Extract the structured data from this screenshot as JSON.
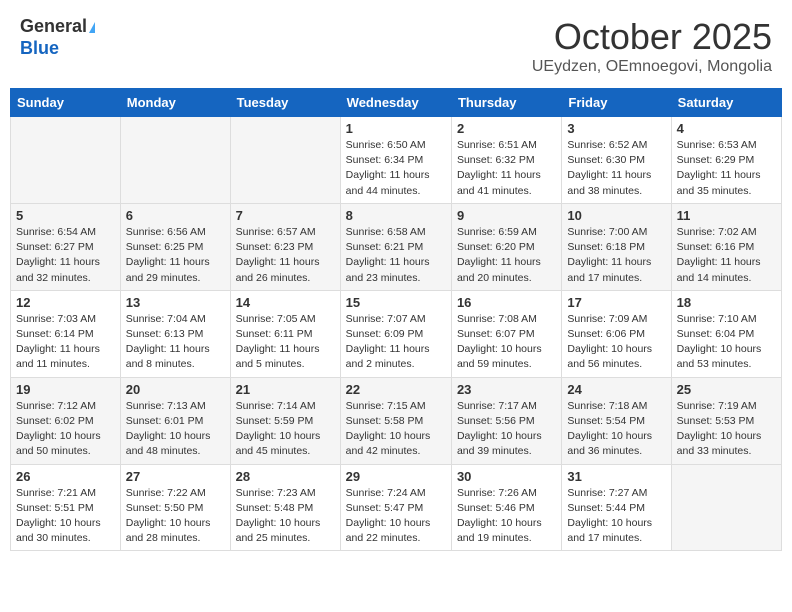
{
  "header": {
    "logo_general": "General",
    "logo_blue": "Blue",
    "month_title": "October 2025",
    "location": "UEydzen, OEmnoegovi, Mongolia"
  },
  "days_of_week": [
    "Sunday",
    "Monday",
    "Tuesday",
    "Wednesday",
    "Thursday",
    "Friday",
    "Saturday"
  ],
  "weeks": [
    [
      {
        "day": "",
        "info": ""
      },
      {
        "day": "",
        "info": ""
      },
      {
        "day": "",
        "info": ""
      },
      {
        "day": "1",
        "info": "Sunrise: 6:50 AM\nSunset: 6:34 PM\nDaylight: 11 hours\nand 44 minutes."
      },
      {
        "day": "2",
        "info": "Sunrise: 6:51 AM\nSunset: 6:32 PM\nDaylight: 11 hours\nand 41 minutes."
      },
      {
        "day": "3",
        "info": "Sunrise: 6:52 AM\nSunset: 6:30 PM\nDaylight: 11 hours\nand 38 minutes."
      },
      {
        "day": "4",
        "info": "Sunrise: 6:53 AM\nSunset: 6:29 PM\nDaylight: 11 hours\nand 35 minutes."
      }
    ],
    [
      {
        "day": "5",
        "info": "Sunrise: 6:54 AM\nSunset: 6:27 PM\nDaylight: 11 hours\nand 32 minutes."
      },
      {
        "day": "6",
        "info": "Sunrise: 6:56 AM\nSunset: 6:25 PM\nDaylight: 11 hours\nand 29 minutes."
      },
      {
        "day": "7",
        "info": "Sunrise: 6:57 AM\nSunset: 6:23 PM\nDaylight: 11 hours\nand 26 minutes."
      },
      {
        "day": "8",
        "info": "Sunrise: 6:58 AM\nSunset: 6:21 PM\nDaylight: 11 hours\nand 23 minutes."
      },
      {
        "day": "9",
        "info": "Sunrise: 6:59 AM\nSunset: 6:20 PM\nDaylight: 11 hours\nand 20 minutes."
      },
      {
        "day": "10",
        "info": "Sunrise: 7:00 AM\nSunset: 6:18 PM\nDaylight: 11 hours\nand 17 minutes."
      },
      {
        "day": "11",
        "info": "Sunrise: 7:02 AM\nSunset: 6:16 PM\nDaylight: 11 hours\nand 14 minutes."
      }
    ],
    [
      {
        "day": "12",
        "info": "Sunrise: 7:03 AM\nSunset: 6:14 PM\nDaylight: 11 hours\nand 11 minutes."
      },
      {
        "day": "13",
        "info": "Sunrise: 7:04 AM\nSunset: 6:13 PM\nDaylight: 11 hours\nand 8 minutes."
      },
      {
        "day": "14",
        "info": "Sunrise: 7:05 AM\nSunset: 6:11 PM\nDaylight: 11 hours\nand 5 minutes."
      },
      {
        "day": "15",
        "info": "Sunrise: 7:07 AM\nSunset: 6:09 PM\nDaylight: 11 hours\nand 2 minutes."
      },
      {
        "day": "16",
        "info": "Sunrise: 7:08 AM\nSunset: 6:07 PM\nDaylight: 10 hours\nand 59 minutes."
      },
      {
        "day": "17",
        "info": "Sunrise: 7:09 AM\nSunset: 6:06 PM\nDaylight: 10 hours\nand 56 minutes."
      },
      {
        "day": "18",
        "info": "Sunrise: 7:10 AM\nSunset: 6:04 PM\nDaylight: 10 hours\nand 53 minutes."
      }
    ],
    [
      {
        "day": "19",
        "info": "Sunrise: 7:12 AM\nSunset: 6:02 PM\nDaylight: 10 hours\nand 50 minutes."
      },
      {
        "day": "20",
        "info": "Sunrise: 7:13 AM\nSunset: 6:01 PM\nDaylight: 10 hours\nand 48 minutes."
      },
      {
        "day": "21",
        "info": "Sunrise: 7:14 AM\nSunset: 5:59 PM\nDaylight: 10 hours\nand 45 minutes."
      },
      {
        "day": "22",
        "info": "Sunrise: 7:15 AM\nSunset: 5:58 PM\nDaylight: 10 hours\nand 42 minutes."
      },
      {
        "day": "23",
        "info": "Sunrise: 7:17 AM\nSunset: 5:56 PM\nDaylight: 10 hours\nand 39 minutes."
      },
      {
        "day": "24",
        "info": "Sunrise: 7:18 AM\nSunset: 5:54 PM\nDaylight: 10 hours\nand 36 minutes."
      },
      {
        "day": "25",
        "info": "Sunrise: 7:19 AM\nSunset: 5:53 PM\nDaylight: 10 hours\nand 33 minutes."
      }
    ],
    [
      {
        "day": "26",
        "info": "Sunrise: 7:21 AM\nSunset: 5:51 PM\nDaylight: 10 hours\nand 30 minutes."
      },
      {
        "day": "27",
        "info": "Sunrise: 7:22 AM\nSunset: 5:50 PM\nDaylight: 10 hours\nand 28 minutes."
      },
      {
        "day": "28",
        "info": "Sunrise: 7:23 AM\nSunset: 5:48 PM\nDaylight: 10 hours\nand 25 minutes."
      },
      {
        "day": "29",
        "info": "Sunrise: 7:24 AM\nSunset: 5:47 PM\nDaylight: 10 hours\nand 22 minutes."
      },
      {
        "day": "30",
        "info": "Sunrise: 7:26 AM\nSunset: 5:46 PM\nDaylight: 10 hours\nand 19 minutes."
      },
      {
        "day": "31",
        "info": "Sunrise: 7:27 AM\nSunset: 5:44 PM\nDaylight: 10 hours\nand 17 minutes."
      },
      {
        "day": "",
        "info": ""
      }
    ]
  ]
}
